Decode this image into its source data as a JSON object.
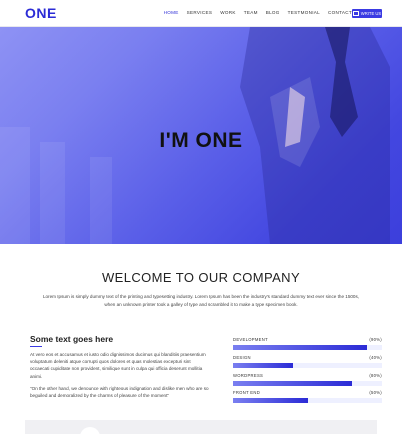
{
  "header": {
    "logo": "ONE",
    "nav": [
      "HOME",
      "SERVICES",
      "WORK",
      "TEAM",
      "BLOG",
      "TESTMONIAL",
      "CONTACT"
    ],
    "cta_label": "WRITE US"
  },
  "hero": {
    "title": "I'M ONE"
  },
  "welcome": {
    "title": "WELCOME TO OUR COMPANY",
    "text": "Lorem Ipsum is simply dummy text of the printing and typesetting industry. Lorem Ipsum has been the industry's standard dummy text ever since the 1500s, when an unknown printer took a galley of type and scrambled it to make a type specimen book."
  },
  "about": {
    "title": "Some text goes here",
    "para1": "At vero eos et accusamus et iusto odio dignissimos ducimus qui blanditiis praesentium voluptatum deleniti atque corrupti quos dolores et quas molestias excepturi sint occaecati cupiditate non provident, similique sunt in culpa qui officia deserunt mollitia animi.",
    "para2": "\"On the other hand, we denounce with righteous indignation and dislike men who are so beguiled and demoralized by the charms of pleasure of the moment\""
  },
  "skills": [
    {
      "name": "DEVELOPMENT",
      "pct_label": "(90%)",
      "value": 90
    },
    {
      "name": "DESIGN",
      "pct_label": "(40%)",
      "value": 40
    },
    {
      "name": "WORDPRESS",
      "pct_label": "(80%)",
      "value": 80
    },
    {
      "name": "FRONT END",
      "pct_label": "(50%)",
      "value": 50
    }
  ],
  "colors": {
    "accent": "#2b2bd6",
    "hero_start": "#8e92f4",
    "hero_end": "#3c3fdc"
  }
}
